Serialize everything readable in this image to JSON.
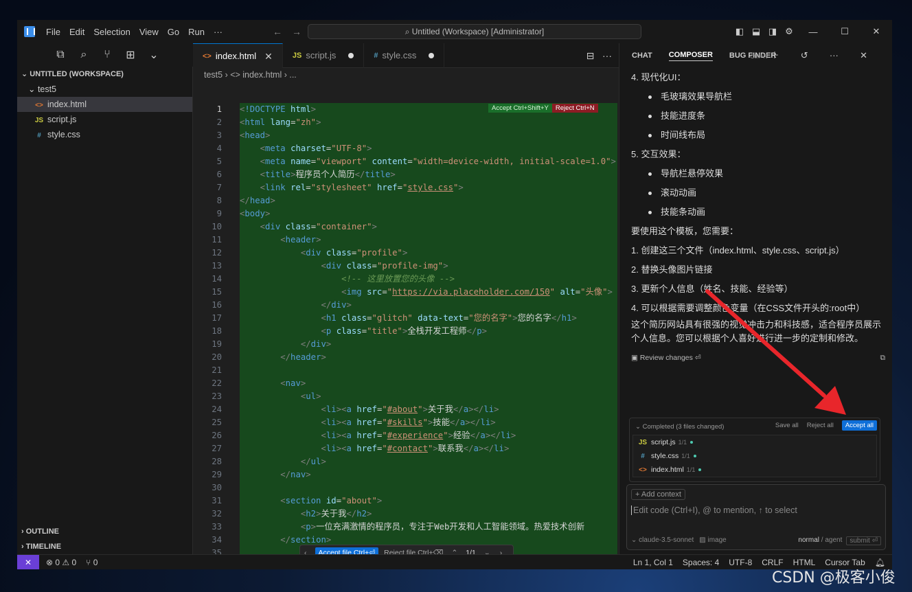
{
  "titlebar": {
    "menu": [
      "File",
      "Edit",
      "Selection",
      "View",
      "Go",
      "Run",
      "···"
    ],
    "search": "Untitled (Workspace) [Administrator]"
  },
  "sidebar": {
    "workspace": "UNTITLED (WORKSPACE)",
    "folder": "test5",
    "files": [
      {
        "icon": "<>",
        "name": "index.html"
      },
      {
        "icon": "JS",
        "name": "script.js"
      },
      {
        "icon": "#",
        "name": "style.css"
      }
    ],
    "outline": "OUTLINE",
    "timeline": "TIMELINE"
  },
  "editor": {
    "tabs": [
      {
        "icon": "<>",
        "label": "index.html"
      },
      {
        "icon": "JS",
        "label": "script.js"
      },
      {
        "icon": "#",
        "label": "style.css"
      }
    ],
    "breadcrumb": "test5  ›  <> index.html  ›  ...",
    "accept_label": "Accept Ctrl+Shift+Y",
    "reject_label": "Reject Ctrl+N",
    "inline_bar": {
      "accept": "Accept file Ctrl+⏎",
      "reject": "Reject file Ctrl+⌫",
      "count": "1/1"
    },
    "lines": [
      "<!DOCTYPE html>",
      "<html lang=\"zh\">",
      "<head>",
      "    <meta charset=\"UTF-8\">",
      "    <meta name=\"viewport\" content=\"width=device-width, initial-scale=1.0\">",
      "    <title>程序员个人简历</title>",
      "    <link rel=\"stylesheet\" href=\"style.css\">",
      "</head>",
      "<body>",
      "    <div class=\"container\">",
      "        <header>",
      "            <div class=\"profile\">",
      "                <div class=\"profile-img\">",
      "                    <!-- 这里放置您的头像 -->",
      "                    <img src=\"https://via.placeholder.com/150\" alt=\"头像\">",
      "                </div>",
      "                <h1 class=\"glitch\" data-text=\"您的名字\">您的名字</h1>",
      "                <p class=\"title\">全栈开发工程师</p>",
      "            </div>",
      "        </header>",
      "",
      "        <nav>",
      "            <ul>",
      "                <li><a href=\"#about\">关于我</a></li>",
      "                <li><a href=\"#skills\">技能</a></li>",
      "                <li><a href=\"#experience\">经验</a></li>",
      "                <li><a href=\"#contact\">联系我</a></li>",
      "            </ul>",
      "        </nav>",
      "",
      "        <section id=\"about\">",
      "            <h2>关于我</h2>",
      "            <p>一位充满激情的程序员，专注于Web开发和人工智能领域。热爱技术创新",
      "        </section>",
      "",
      "        <section id=\"skills\">"
    ]
  },
  "panel": {
    "tabs": [
      "CHAT",
      "COMPOSER",
      "BUG FINDER"
    ],
    "shortcut": "Ctrl+N",
    "content": [
      {
        "type": "p",
        "text": "4. 现代化UI："
      },
      {
        "type": "b",
        "text": "毛玻璃效果导航栏"
      },
      {
        "type": "b",
        "text": "技能进度条"
      },
      {
        "type": "b",
        "text": "时间线布局"
      },
      {
        "type": "p",
        "text": "5. 交互效果："
      },
      {
        "type": "b",
        "text": "导航栏悬停效果"
      },
      {
        "type": "b",
        "text": "滚动动画"
      },
      {
        "type": "b",
        "text": "技能条动画"
      },
      {
        "type": "p",
        "text": "要使用这个模板，您需要："
      },
      {
        "type": "p",
        "text": "1. 创建这三个文件（index.html、style.css、script.js）"
      },
      {
        "type": "p",
        "text": "2. 替换头像图片链接"
      },
      {
        "type": "p",
        "text": "3. 更新个人信息（姓名、技能、经验等）"
      },
      {
        "type": "p",
        "text": "4. 可以根据需要调整颜色变量（在CSS文件开头的:root中）"
      },
      {
        "type": "w",
        "text": "这个简历网站具有很强的视觉冲击力和科技感，适合程序员展示个人信息。您可以根据个人喜好进行进一步的定制和修改。"
      }
    ],
    "review": "Review changes ⏎",
    "changes": {
      "header": "Completed (3 files changed)",
      "save_all": "Save all",
      "reject_all": "Reject all",
      "accept_all": "Accept all",
      "files": [
        {
          "icon": "JS",
          "name": "script.js",
          "meta": "1/1"
        },
        {
          "icon": "#",
          "name": "style.css",
          "meta": "1/1"
        },
        {
          "icon": "<>",
          "name": "index.html",
          "meta": "1/1"
        }
      ]
    },
    "composer": {
      "add_context": "+ Add context",
      "placeholder": "Edit code (Ctrl+I), @ to mention, ↑ to select",
      "model": "claude-3.5-sonnet",
      "image": "image",
      "mode": "normal",
      "agent": "/ agent",
      "submit": "submit ⏎"
    }
  },
  "status": {
    "problems": "⊗ 0 ⚠ 0",
    "ports": "⑂ 0",
    "position": "Ln 1, Col 1",
    "spaces": "Spaces: 4",
    "encoding": "UTF-8",
    "eol": "CRLF",
    "lang": "HTML",
    "tab": "Cursor Tab"
  },
  "watermark": "CSDN @极客小俊",
  "colors": {
    "accent": "#0e6fd8",
    "diff_bg": "#17491d",
    "arrow": "#e8262b",
    "remote": "#6a3fd6"
  }
}
